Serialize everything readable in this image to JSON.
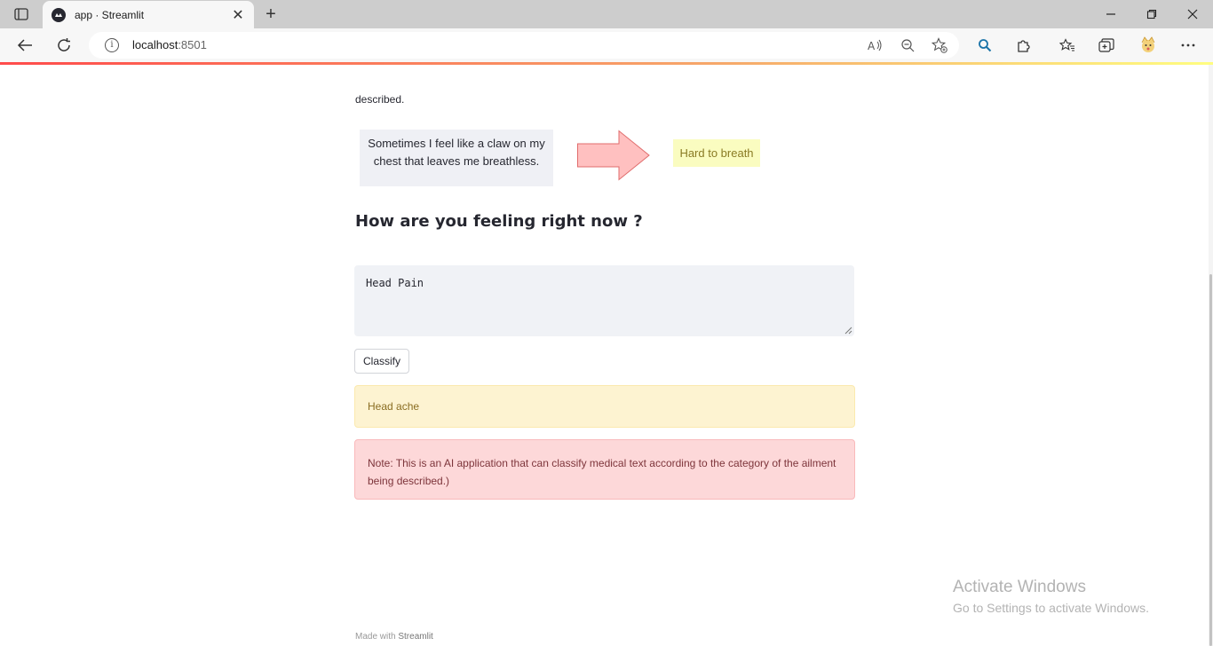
{
  "browser": {
    "tab_title": "app · Streamlit",
    "url_host": "localhost",
    "url_port": ":8501",
    "new_tab_glyph": "+",
    "close_glyph": "✕"
  },
  "page": {
    "intro_tail": "described.",
    "example_input": "Sometimes I feel like a claw on my chest that leaves me breathless.",
    "example_output": "Hard to breath",
    "heading": "How are you feeling right now ?",
    "input_value": "Head Pain",
    "classify_label": "Classify",
    "result": "Head ache",
    "note": "Note: This is an AI application that can classify medical text according to the category of the ailment being described.)",
    "footer_prefix": "Made with ",
    "footer_brand": "Streamlit"
  },
  "os": {
    "activate_title": "Activate Windows",
    "activate_sub": "Go to Settings to activate Windows."
  },
  "colors": {
    "accent_red": "#ff4b4b",
    "warning_bg": "#fdf3d1",
    "error_bg": "#fdd8d9",
    "example_result_bg": "#fafcc0",
    "arrow_fill": "#ffc0c0"
  },
  "icons": [
    "tab-actions-icon",
    "streamlit-favicon",
    "close-icon",
    "plus-icon",
    "minimize-icon",
    "restore-icon",
    "window-close-icon",
    "back-arrow-icon",
    "refresh-icon",
    "info-icon",
    "read-aloud-icon",
    "zoom-out-icon",
    "favorite-add-icon",
    "search-icon",
    "extensions-icon",
    "favorites-icon",
    "collections-icon",
    "profile-icon",
    "more-icon",
    "right-arrow-icon"
  ]
}
